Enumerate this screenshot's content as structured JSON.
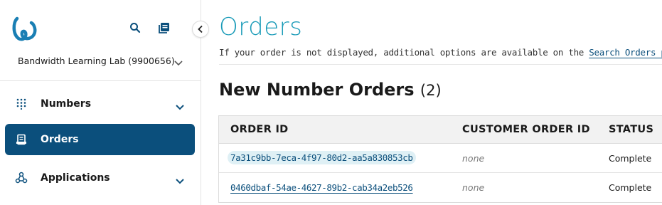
{
  "sidebar": {
    "account_name": "Bandwidth Learning Lab (9900656)",
    "items": [
      {
        "label": "Numbers",
        "icon": "dialpad-icon",
        "expandable": true
      },
      {
        "label": "Orders",
        "icon": "orders-icon",
        "active": true
      },
      {
        "label": "Applications",
        "icon": "applications-icon",
        "expandable": true
      }
    ],
    "active_color": "#0b4f7c"
  },
  "main": {
    "title": "Orders",
    "notice_text": "If your order is not displayed, additional options are available on the ",
    "notice_link": "Search Orders page",
    "notice_suffix": ".",
    "section_title": "New Number Orders",
    "section_count": "(2)",
    "table": {
      "columns": [
        "ORDER ID",
        "CUSTOMER ORDER ID",
        "STATUS"
      ],
      "rows": [
        {
          "order_id": "7a31c9bb-7eca-4f97-80d2-aa5a830853cb",
          "customer_order_id": "none",
          "status": "Complete"
        },
        {
          "order_id": "0460dbaf-54ae-4627-89b2-cab34a2eb526",
          "customer_order_id": "none",
          "status": "Complete"
        }
      ]
    }
  },
  "colors": {
    "title": "#1a9bb8",
    "link": "#0b4f7c"
  }
}
